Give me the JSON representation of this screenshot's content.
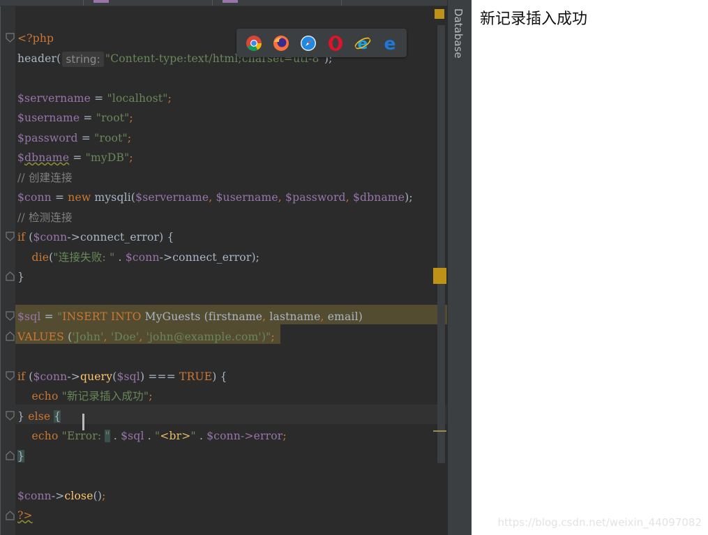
{
  "editor": {
    "lines": [
      [
        {
          "t": "<?php",
          "c": "p"
        }
      ],
      [
        {
          "t": "header(",
          "c": ""
        },
        {
          "t": "string:",
          "c": "hint"
        },
        {
          "t": "\"Content-type:text/html;charset=utf-8\"",
          "c": "s"
        },
        {
          "t": ");",
          "c": ""
        }
      ],
      [],
      [
        {
          "t": "$servername",
          "c": "v"
        },
        {
          "t": " = ",
          "c": ""
        },
        {
          "t": "\"localhost\"",
          "c": "s"
        },
        {
          "t": ";",
          "c": "k"
        }
      ],
      [
        {
          "t": "$username",
          "c": "v"
        },
        {
          "t": " = ",
          "c": ""
        },
        {
          "t": "\"root\"",
          "c": "s"
        },
        {
          "t": ";",
          "c": "k"
        }
      ],
      [
        {
          "t": "$password",
          "c": "v"
        },
        {
          "t": " = ",
          "c": ""
        },
        {
          "t": "\"root\"",
          "c": "s"
        },
        {
          "t": ";",
          "c": "k"
        }
      ],
      [
        {
          "t": "$",
          "c": "v"
        },
        {
          "t": "dbname",
          "c": "v squig"
        },
        {
          "t": " = ",
          "c": ""
        },
        {
          "t": "\"myDB\"",
          "c": "s"
        },
        {
          "t": ";",
          "c": "k"
        }
      ],
      [
        {
          "t": "// 创建连接",
          "c": "c"
        }
      ],
      [
        {
          "t": "$conn",
          "c": "v"
        },
        {
          "t": " = ",
          "c": ""
        },
        {
          "t": "new ",
          "c": "k"
        },
        {
          "t": "mysqli(",
          "c": ""
        },
        {
          "t": "$servername",
          "c": "v"
        },
        {
          "t": ", ",
          "c": "k"
        },
        {
          "t": "$username",
          "c": "v"
        },
        {
          "t": ", ",
          "c": "k"
        },
        {
          "t": "$password",
          "c": "v"
        },
        {
          "t": ", ",
          "c": "k"
        },
        {
          "t": "$dbname",
          "c": "v"
        },
        {
          "t": ");",
          "c": ""
        }
      ],
      [
        {
          "t": "// 检测连接",
          "c": "c"
        }
      ],
      [
        {
          "t": "if ",
          "c": "k"
        },
        {
          "t": "(",
          "c": ""
        },
        {
          "t": "$conn",
          "c": "v"
        },
        {
          "t": "->connect_error) {",
          "c": ""
        }
      ],
      [
        {
          "t": "    ",
          "c": ""
        },
        {
          "t": "die",
          "c": "k"
        },
        {
          "t": "(",
          "c": ""
        },
        {
          "t": "\"连接失败: \"",
          "c": "s"
        },
        {
          "t": " . ",
          "c": ""
        },
        {
          "t": "$conn",
          "c": "v"
        },
        {
          "t": "->connect_error);",
          "c": ""
        }
      ],
      [
        {
          "t": "}",
          "c": ""
        }
      ],
      [],
      [
        {
          "t": "$sql",
          "c": "v"
        },
        {
          "t": " = ",
          "c": ""
        },
        {
          "t": "\"",
          "c": "s"
        },
        {
          "t": "INSERT INTO ",
          "c": "k"
        },
        {
          "t": "MyGuests (firstname",
          "c": ""
        },
        {
          "t": ", ",
          "c": "k"
        },
        {
          "t": "lastname",
          "c": ""
        },
        {
          "t": ", ",
          "c": "k"
        },
        {
          "t": "email)",
          "c": ""
        }
      ],
      [
        {
          "t": "VALUES ",
          "c": "k"
        },
        {
          "t": "(",
          "c": ""
        },
        {
          "t": "'John'",
          "c": "s"
        },
        {
          "t": ", ",
          "c": "k"
        },
        {
          "t": "'Doe'",
          "c": "s"
        },
        {
          "t": ", ",
          "c": "k"
        },
        {
          "t": "'john@example.com'",
          "c": "s"
        },
        {
          "t": ")\"",
          "c": "s"
        },
        {
          "t": ";",
          "c": "k"
        }
      ],
      [],
      [
        {
          "t": "if ",
          "c": "k"
        },
        {
          "t": "(",
          "c": ""
        },
        {
          "t": "$conn",
          "c": "v"
        },
        {
          "t": "->",
          "c": ""
        },
        {
          "t": "query",
          "c": "f"
        },
        {
          "t": "(",
          "c": ""
        },
        {
          "t": "$sql",
          "c": "v"
        },
        {
          "t": ") === ",
          "c": ""
        },
        {
          "t": "TRUE",
          "c": "k"
        },
        {
          "t": ") {",
          "c": ""
        }
      ],
      [
        {
          "t": "    ",
          "c": ""
        },
        {
          "t": "echo ",
          "c": "k"
        },
        {
          "t": "\"新记录插入成功\"",
          "c": "s"
        },
        {
          "t": ";",
          "c": "k"
        }
      ],
      [
        {
          "t": "} ",
          "c": ""
        },
        {
          "t": "else ",
          "c": "k"
        },
        {
          "t": "{",
          "c": "brace"
        }
      ],
      [
        {
          "t": "    ",
          "c": ""
        },
        {
          "t": "echo ",
          "c": "k"
        },
        {
          "t": "\"Error: ",
          "c": "s"
        },
        {
          "t": "\"",
          "c": "s brace"
        },
        {
          "t": " . ",
          "c": ""
        },
        {
          "t": "$sql",
          "c": "v"
        },
        {
          "t": " . ",
          "c": ""
        },
        {
          "t": "\"",
          "c": "s"
        },
        {
          "t": "<br>",
          "c": "t"
        },
        {
          "t": "\"",
          "c": "s"
        },
        {
          "t": " . ",
          "c": ""
        },
        {
          "t": "$conn",
          "c": "v"
        },
        {
          "t": "->error",
          "c": "v"
        },
        {
          "t": ";",
          "c": "k"
        }
      ],
      [
        {
          "t": "}",
          "c": "brace"
        }
      ],
      [],
      [
        {
          "t": "$conn",
          "c": "v"
        },
        {
          "t": "->",
          "c": ""
        },
        {
          "t": "close",
          "c": "f"
        },
        {
          "t": "()",
          "c": ""
        },
        {
          "t": ";",
          "c": "k"
        }
      ],
      [
        {
          "t": "?>",
          "c": "p squig"
        }
      ]
    ]
  },
  "sidebar": {
    "label": "Database"
  },
  "browsers": [
    "chrome-icon",
    "firefox-icon",
    "safari-icon",
    "opera-icon",
    "internet-explorer-icon",
    "edge-icon"
  ],
  "output": {
    "message": "新记录插入成功"
  },
  "watermark": "https://blog.csdn.net/weixin_44097082",
  "colors": {
    "keyword": "#cc7832",
    "variable": "#9876aa",
    "string": "#6a8759",
    "comment": "#808080",
    "function": "#ffc66d",
    "selection": "#5a5233",
    "current_line": "#323232"
  }
}
